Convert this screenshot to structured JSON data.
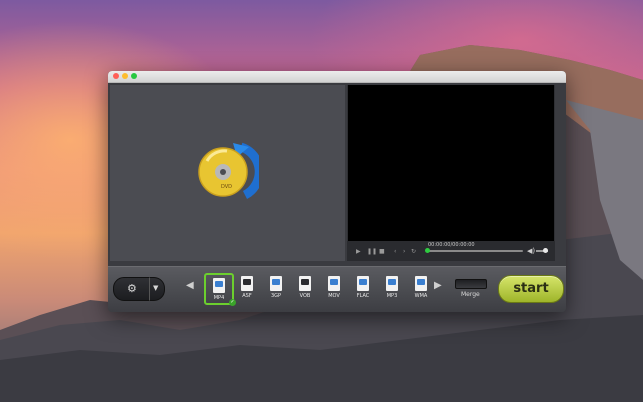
{
  "player": {
    "timecode": "00:00:00/00:00:00",
    "volume_level": 0.6,
    "seek_position": 0.0
  },
  "formats": [
    {
      "label": "MP4",
      "selected": true
    },
    {
      "label": "ASF",
      "selected": false
    },
    {
      "label": "3GP",
      "selected": false
    },
    {
      "label": "VOB",
      "selected": false
    },
    {
      "label": "MOV",
      "selected": false
    },
    {
      "label": "FLAC",
      "selected": false
    },
    {
      "label": "MP3",
      "selected": false
    },
    {
      "label": "WMA",
      "selected": false
    }
  ],
  "toolbar": {
    "merge_label": "Merge",
    "start_label": "start"
  },
  "disc_logo": {
    "text": "DVD"
  },
  "colors": {
    "start_button": "#bfd24a",
    "selected_format_border": "#6ccf2e",
    "seek_knob": "#2ecc40"
  },
  "icons": {
    "settings": "gear-icon",
    "dropdown": "chevron-down-icon",
    "nav_left": "chevron-left-icon",
    "nav_right": "chevron-right-icon",
    "play": "play-icon",
    "pause": "pause-icon",
    "stop": "stop-icon",
    "volume": "speaker-icon"
  }
}
